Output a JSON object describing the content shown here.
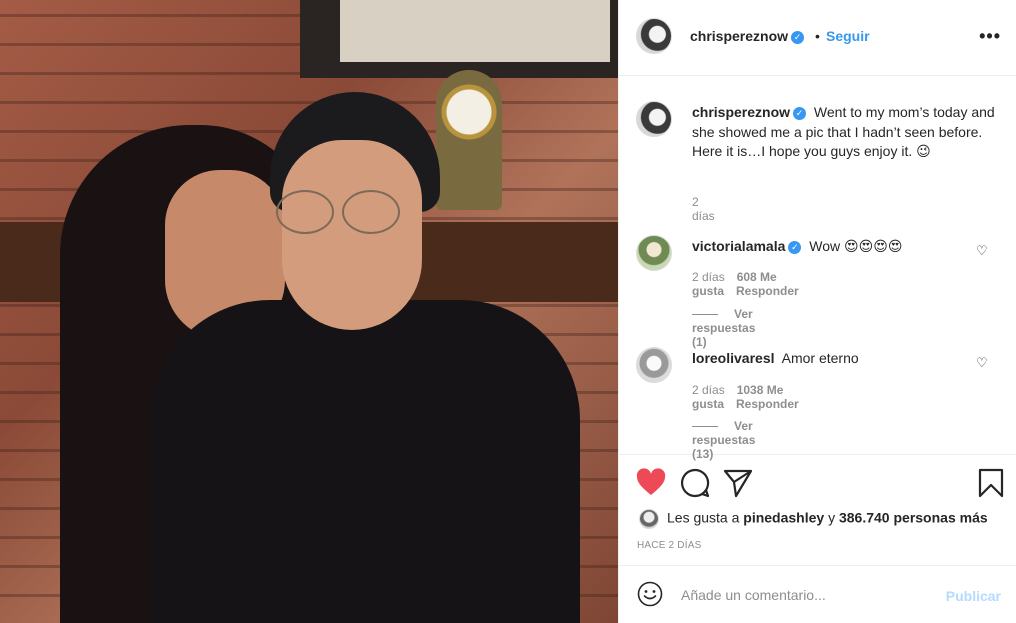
{
  "header": {
    "username": "chrispereznow",
    "verified_mark": "✓",
    "separator": "•",
    "follow_label": "Seguir",
    "more_label": "•••"
  },
  "caption": {
    "username": "chrispereznow",
    "text": "Went to my mom’s today and she showed me a pic that I hadn’t seen before. Here it is…I hope you guys enjoy it. 😉",
    "time": "2 días"
  },
  "comments": [
    {
      "username": "victorialamala",
      "verified": true,
      "text": "Wow 😍😍😍😍",
      "time": "2 días",
      "likes": "608 Me gusta",
      "reply_label": "Responder",
      "view_replies": "Ver respuestas (1)"
    },
    {
      "username": "loreolivaresl",
      "verified": false,
      "text": "Amor eterno",
      "time": "2 días",
      "likes": "1038 Me gusta",
      "reply_label": "Responder",
      "view_replies": "Ver respuestas (13)"
    }
  ],
  "likes": {
    "prefix": "Les gusta a",
    "liker": "pinedashley",
    "connector": "y",
    "count": "386.740 personas más"
  },
  "post_time": "HACE 2 DÍAS",
  "add_comment": {
    "placeholder": "Añade un comentario...",
    "publish_label": "Publicar"
  },
  "colors": {
    "heart": "#ed4956",
    "link_blue": "#3897f0",
    "publish_disabled": "#b3dbff"
  }
}
